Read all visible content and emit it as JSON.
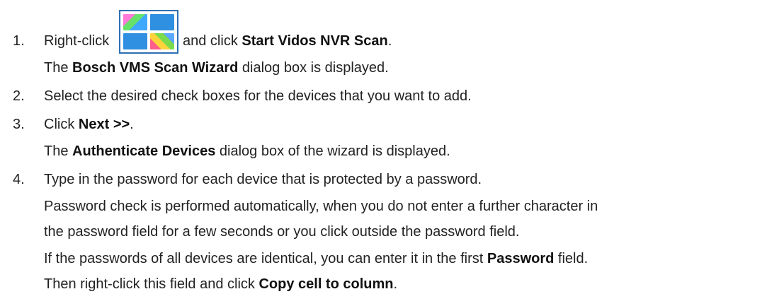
{
  "steps": [
    {
      "number": "1.",
      "pre": "Right-click",
      "post": "and click",
      "bold": "Start Vidos NVR Scan",
      "end": "."
    },
    {
      "line": "The",
      "bold": "Bosch VMS Scan Wizard",
      "end": "dialog box is displayed."
    },
    {
      "number": "2.",
      "text": "Select the desired check boxes for the devices that you want to add."
    },
    {
      "number": "3.",
      "pre": "Click",
      "bold": "Next >>",
      "end": "."
    },
    {
      "line": "The",
      "bold": "Authenticate Devices",
      "end": "dialog box of the wizard is displayed."
    },
    {
      "number": "4.",
      "text": "Type in the password for each device that is protected by a password."
    },
    {
      "line": "Password check is performed automatically, when you do not enter a further character in"
    },
    {
      "line": "the password field for a few seconds or you click outside the password field."
    },
    {
      "line": "If the passwords of all devices are identical, you can enter it in the first",
      "bold": "Password",
      "end": "field."
    },
    {
      "line": "Then right-click this field and click",
      "bold": "Copy cell to column",
      "end": "."
    }
  ],
  "icon": {
    "name": "vidos-nvr-grid-icon",
    "colors": [
      "#2f6fb3",
      "#2f8fe0",
      "#ff7ad9",
      "#66e26b",
      "#ffd43b",
      "#ff5e8a"
    ]
  }
}
